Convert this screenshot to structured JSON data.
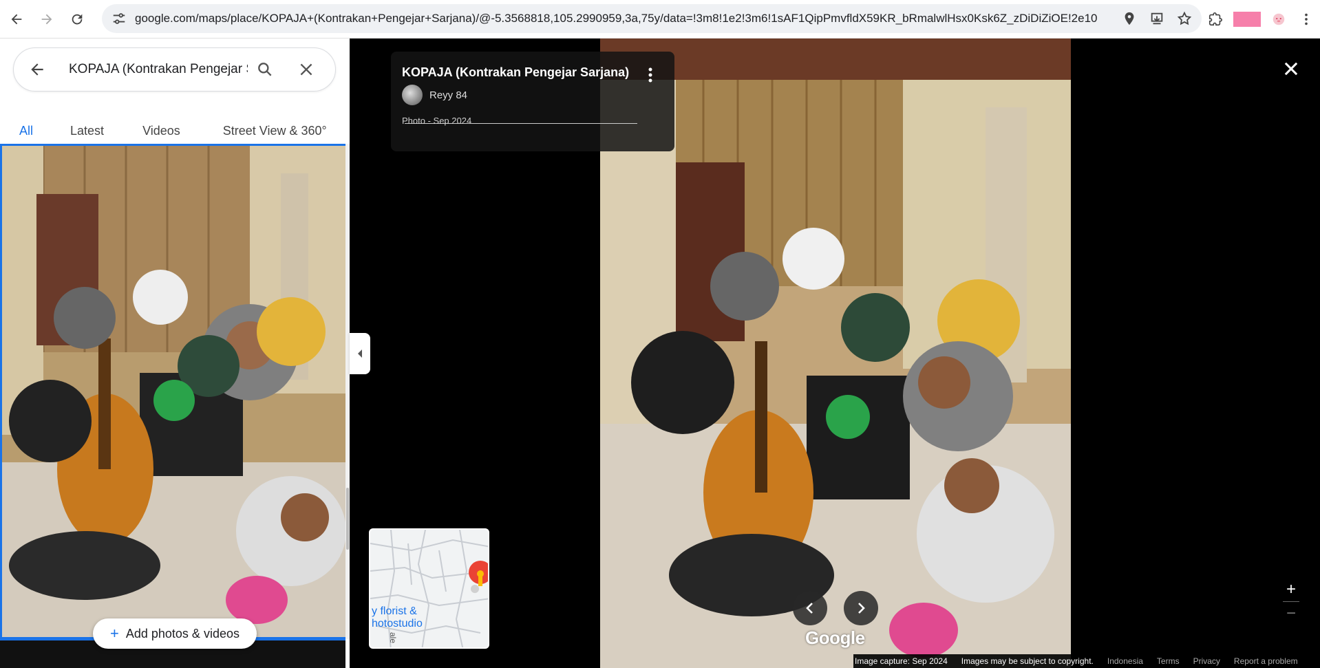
{
  "browser": {
    "url": "google.com/maps/place/KOPAJA+(Kontrakan+Pengejar+Sarjana)/@-5.3568818,105.2990959,3a,75y/data=!3m8!1e2!3m6!1sAF1QipPmvfldX59KR_bRmalwlHsx0Ksk6Z_zDiDiZiOE!2e10!..."
  },
  "search": {
    "query": "KOPAJA (Kontrakan Pengejar Sarjana)"
  },
  "tabs": [
    {
      "label": "All",
      "active": true
    },
    {
      "label": "Latest",
      "active": false
    },
    {
      "label": "Videos",
      "active": false
    },
    {
      "label": "Street View & 360°",
      "active": false
    }
  ],
  "add_button": {
    "label": "Add photos & videos"
  },
  "photo_info": {
    "title": "KOPAJA (Kontrakan Pengejar Sarjana)",
    "author": "Reyy 84",
    "date": "Photo - Sep 2024"
  },
  "minimap": {
    "text_line1": "y florist &",
    "text_line2": "hotostudio",
    "text_line3": "ale"
  },
  "branding": {
    "logo": "Google"
  },
  "footer": {
    "capture": "Image capture: Sep 2024",
    "copyright": "Images may be subject to copyright.",
    "region": "Indonesia",
    "terms": "Terms",
    "privacy": "Privacy",
    "report": "Report a problem"
  },
  "colors": {
    "accent": "#1a73e8",
    "pin": "#ea4335"
  }
}
